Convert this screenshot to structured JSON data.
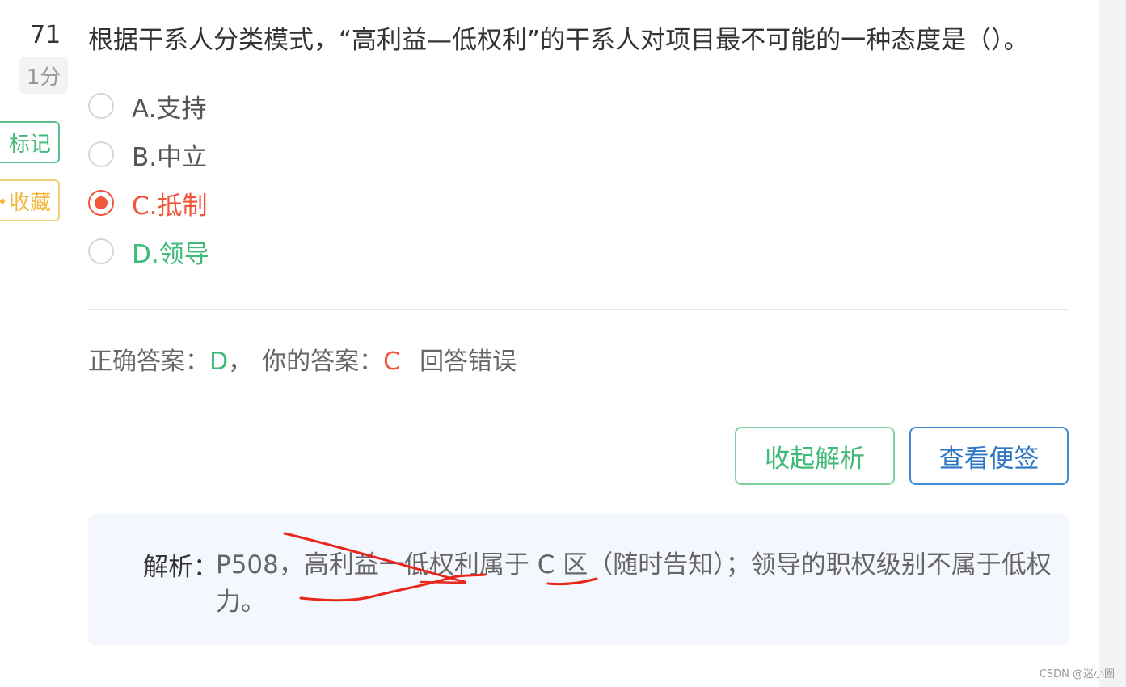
{
  "question": {
    "number": "71",
    "score": "1分",
    "text": "根据干系人分类模式，“高利益—低权利”的干系人对项目最不可能的一种态度是（）。"
  },
  "side_buttons": {
    "mark": "标记",
    "favorite": "收藏"
  },
  "options": [
    {
      "label": "A.支持",
      "selected": false,
      "state": "normal"
    },
    {
      "label": "B.中立",
      "selected": false,
      "state": "normal"
    },
    {
      "label": "C.抵制",
      "selected": true,
      "state": "wrong"
    },
    {
      "label": "D.领导",
      "selected": false,
      "state": "correct"
    }
  ],
  "answer": {
    "correct_label": "正确答案：",
    "correct_value": "D",
    "separator": "，",
    "yours_label": "你的答案：",
    "yours_value": "C",
    "result": "回答错误"
  },
  "buttons": {
    "collapse": "收起解析",
    "notes": "查看便签"
  },
  "analysis": {
    "label": "解析：",
    "text": "P508，高利益一低权利属于 C 区（随时告知）；领导的职权级别不属于低权力。"
  },
  "colors": {
    "correct": "#3fba78",
    "wrong": "#f0573b",
    "blue": "#2b76c4",
    "annotation": "#e8261b"
  },
  "watermark": "CSDN @迷小圈"
}
